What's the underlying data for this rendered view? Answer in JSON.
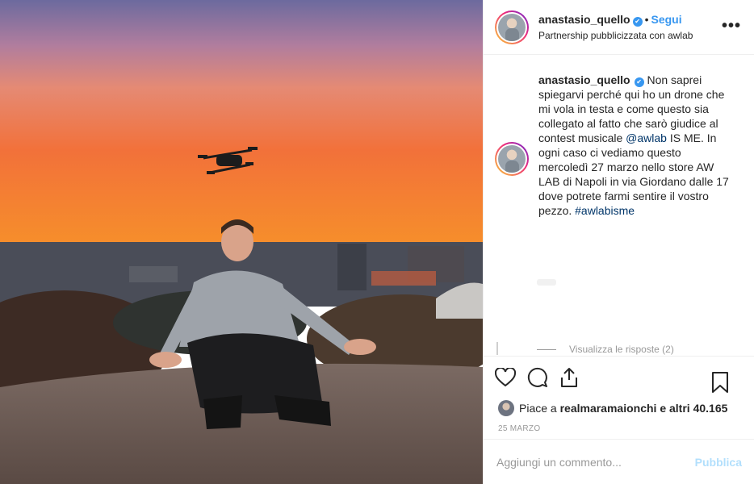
{
  "photo": {
    "alt": "",
    "colors": {
      "sky_top": "#6f6a9f",
      "sky_mid": "#e8826a",
      "sky_low": "#f26a2a",
      "horizon": "#f5801f",
      "ground": "#6b5a52"
    }
  },
  "header": {
    "username": "anastasio_quello",
    "verified_icon": "verified-badge-icon",
    "separator": "•",
    "follow_label": "Segui",
    "subtitle": "Partnership pubblicizzata con awlab",
    "more_label": "•••"
  },
  "caption": {
    "username": "anastasio_quello",
    "text_1": "Non saprei spiegarvi perché qui ho un drone che mi vola in testa e come questo sia collegato al fatto che sarò giudice al contest musicale ",
    "mention": "@awlab",
    "text_2": " IS ME. In ogni caso ci vediamo questo mercoledì 27 marzo nello store AW LAB di Napoli in via Giordano dalle 17 dove potrete farmi sentire il vostro pezzo. ",
    "hashtag": "#awlabisme"
  },
  "replies": {
    "label": "Visualizza le risposte (2)"
  },
  "actions": {
    "like_icon": "heart-icon",
    "comment_icon": "comment-icon",
    "share_icon": "share-icon",
    "save_icon": "bookmark-icon"
  },
  "likes": {
    "prefix": "Piace a ",
    "user": "realmaramaionchi",
    "suffix": " e altri 40.165"
  },
  "date": "25 MARZO",
  "comment_box": {
    "placeholder": "Aggiungi un commento...",
    "publish_label": "Pubblica"
  },
  "accent_color": "#3897f0"
}
